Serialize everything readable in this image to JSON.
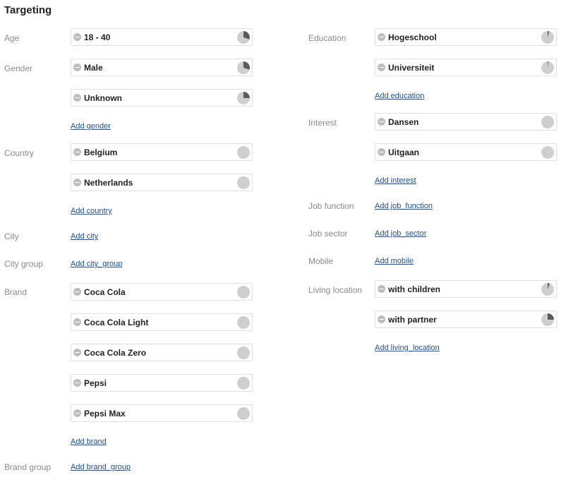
{
  "title": "Targeting",
  "labels": {
    "age": "Age",
    "gender": "Gender",
    "country": "Country",
    "city": "City",
    "city_group": "City group",
    "brand": "Brand",
    "brand_group": "Brand group",
    "education": "Education",
    "interest": "Interest",
    "job_function": "Job function",
    "job_sector": "Job sector",
    "mobile": "Mobile",
    "living_location": "Living location"
  },
  "chips": {
    "age_18_40": {
      "text": "18 - 40",
      "share": 0.3
    },
    "gender_male": {
      "text": "Male",
      "share": 0.3
    },
    "gender_unknown": {
      "text": "Unknown",
      "share": 0.25
    },
    "country_belgium": {
      "text": "Belgium",
      "share": 0
    },
    "country_netherlands": {
      "text": "Netherlands",
      "share": 0
    },
    "brand_coca_cola": {
      "text": "Coca Cola",
      "share": 0
    },
    "brand_coca_cola_light": {
      "text": "Coca Cola Light",
      "share": 0
    },
    "brand_coca_cola_zero": {
      "text": "Coca Cola Zero",
      "share": 0
    },
    "brand_pepsi": {
      "text": "Pepsi",
      "share": 0
    },
    "brand_pepsi_max": {
      "text": "Pepsi Max",
      "share": 0
    },
    "education_hogeschool": {
      "text": "Hogeschool",
      "share": 0.04
    },
    "education_universiteit": {
      "text": "Universiteit",
      "share": 0.02
    },
    "interest_dansen": {
      "text": "Dansen",
      "share": 0
    },
    "interest_uitgaan": {
      "text": "Uitgaan",
      "share": 0
    },
    "living_with_children": {
      "text": "with children",
      "share": 0.05
    },
    "living_with_partner": {
      "text": "with partner",
      "share": 0.25
    }
  },
  "links": {
    "add_gender": "Add gender",
    "add_country": "Add country",
    "add_city": "Add city",
    "add_city_group": "Add city_group",
    "add_brand": "Add brand",
    "add_brand_group": "Add brand_group",
    "add_education": "Add education",
    "add_interest": "Add interest",
    "add_job_function": "Add job_function",
    "add_job_sector": "Add job_sector",
    "add_mobile": "Add mobile",
    "add_living_location": "Add living_location"
  },
  "colors": {
    "link": "#1f4e8a",
    "pie_bg": "#cfcfcf",
    "pie_fill": "#5a5a5a"
  }
}
